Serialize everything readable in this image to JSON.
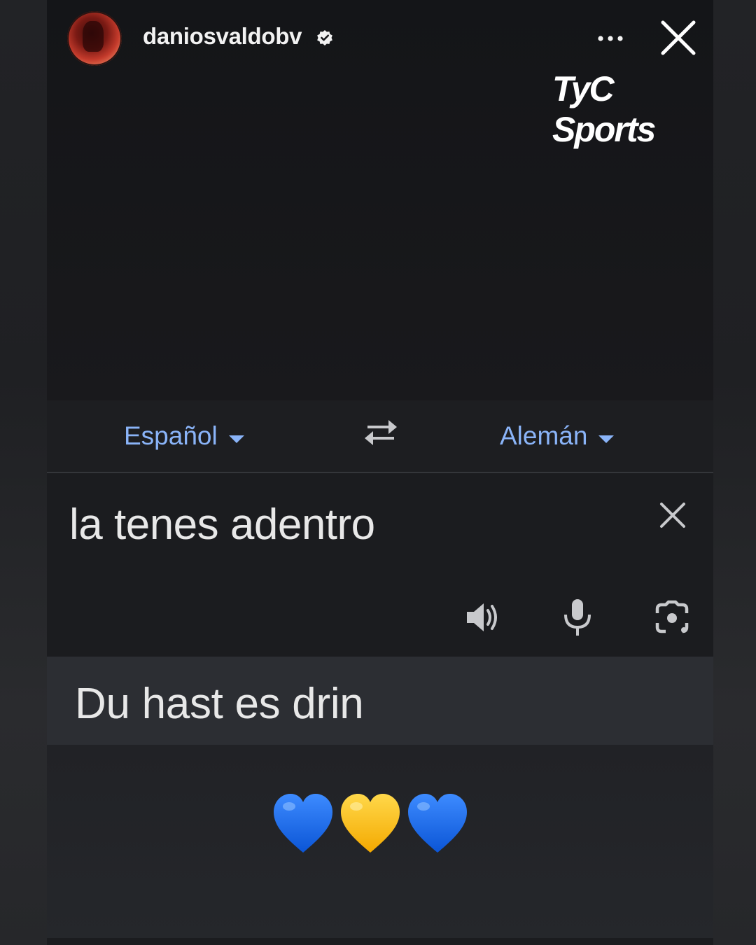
{
  "story": {
    "username": "daniosvaldobv",
    "verified": true,
    "brand_logo": "TyC Sports"
  },
  "translator": {
    "source_language": "Español",
    "target_language": "Alemán",
    "source_text": "la tenes adentro",
    "translated_text": "Du hast es drin"
  },
  "icons": {
    "more": "more-horizontal-icon",
    "close": "close-icon",
    "swap": "swap-languages-icon",
    "clear": "clear-icon",
    "speaker": "speaker-icon",
    "mic": "microphone-icon",
    "lens": "camera-lens-icon"
  },
  "stickers": {
    "hearts": [
      "blue-heart",
      "yellow-heart",
      "blue-heart"
    ]
  },
  "colors": {
    "link_blue": "#8ab4f8",
    "heart_blue": "#1e6fe8",
    "heart_yellow": "#ffc61a"
  }
}
